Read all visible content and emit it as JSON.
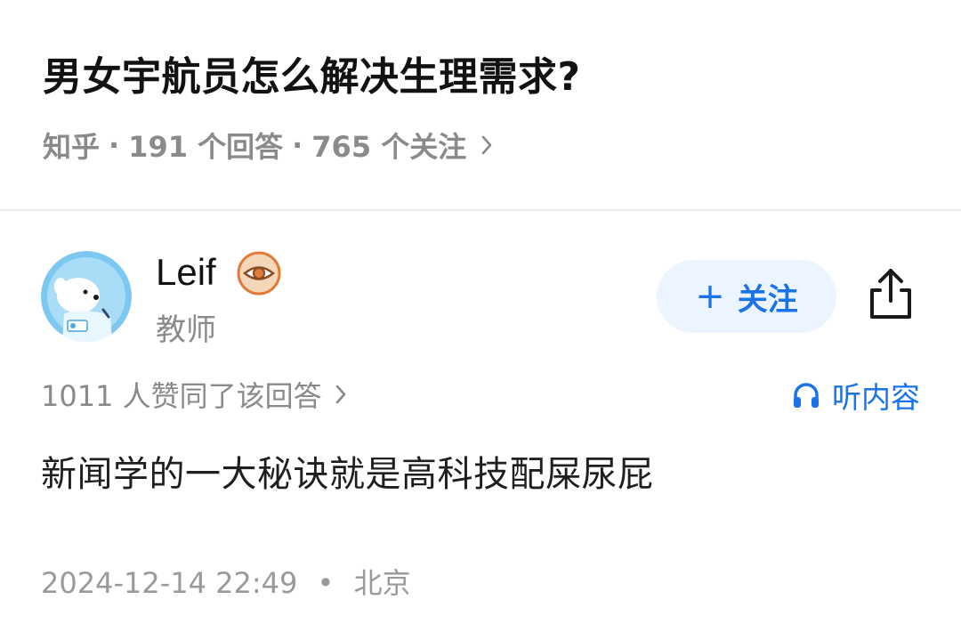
{
  "question": {
    "title": "男女宇航员怎么解决生理需求?",
    "source": "知乎",
    "answers": "191 个回答",
    "followers": "765 个关注",
    "separator": "·"
  },
  "author": {
    "name": "Leif",
    "title": "教师",
    "follow_label": "关注",
    "follow_icon": "+",
    "badge_icon": "eye-badge-icon",
    "avatar_icon": "astronaut-dog-avatar"
  },
  "answer": {
    "upvotes": "1011 人赞同了该回答",
    "listen_label": "听内容",
    "content": "新闻学的一大秘诀就是高科技配屎尿屁",
    "date": "2024-12-14 22:49",
    "sep": "•",
    "location": "北京"
  },
  "colors": {
    "accent": "#1a73e8",
    "follow_bg": "#ebf4ff",
    "meta_gray": "#8a8a8a",
    "avatar_bg": "#7cc8f0",
    "badge": "#e07b3a"
  }
}
